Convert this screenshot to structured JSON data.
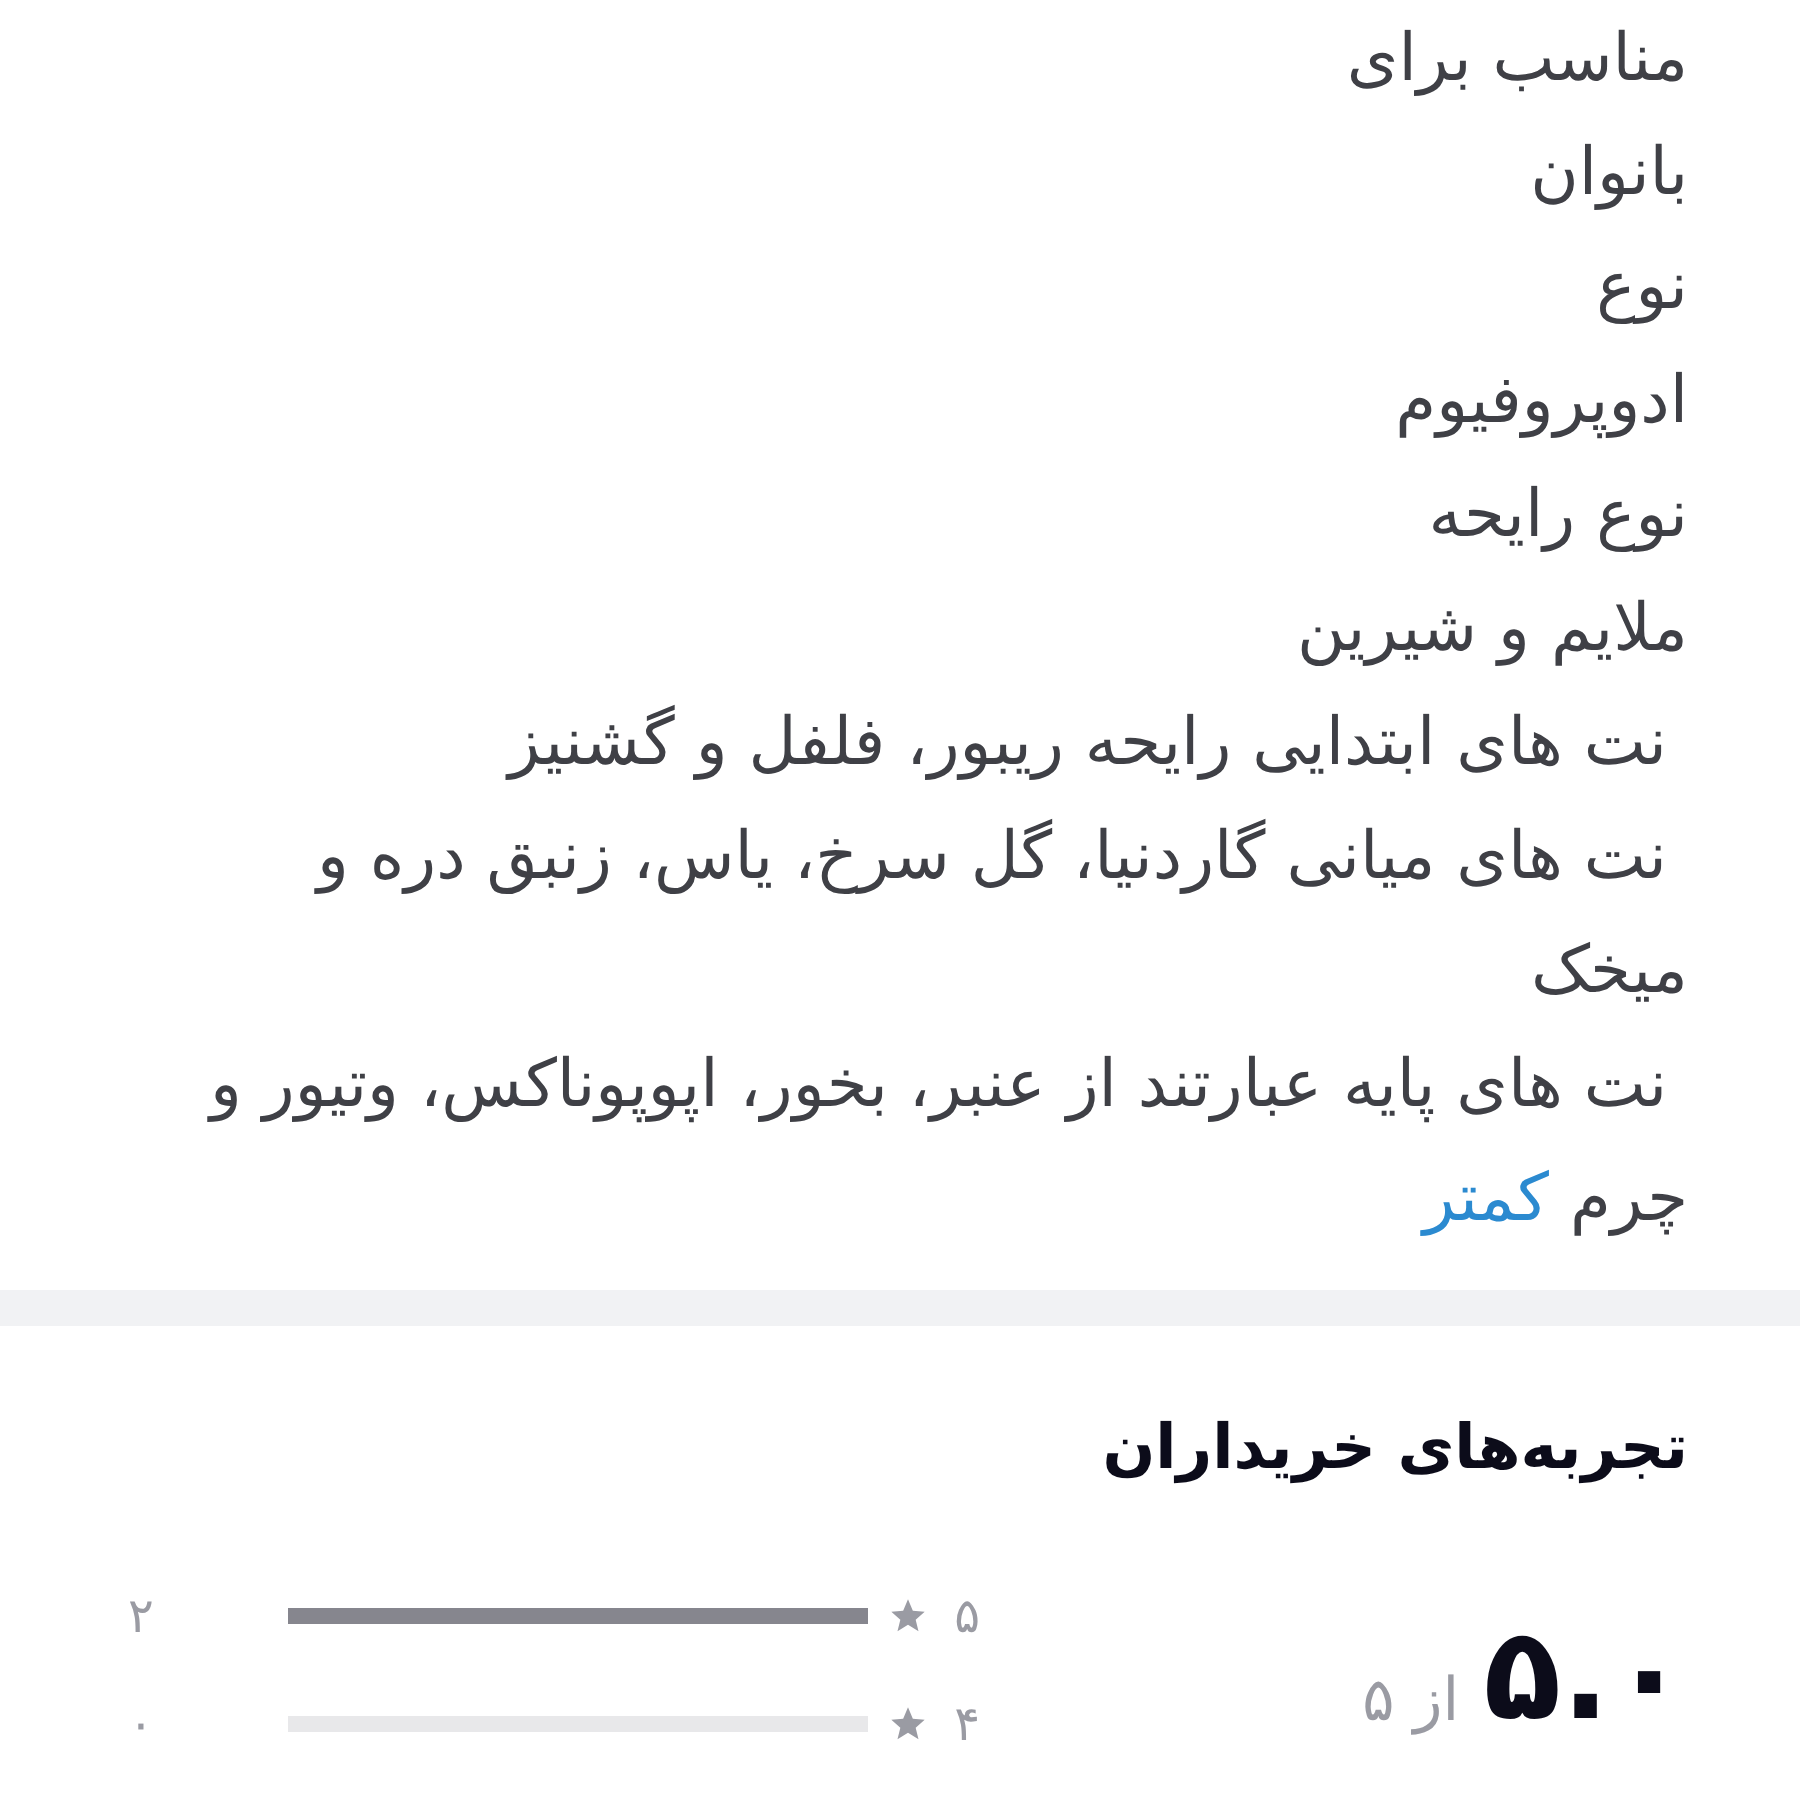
{
  "specs": [
    {
      "label": "مناسب برای",
      "value": "بانوان"
    },
    {
      "label": "نوع",
      "value": "ادوپروفیوم"
    },
    {
      "label": "نوع رایحه",
      "value": "ملایم و شیرین"
    }
  ],
  "notes": [
    " نت های ابتدایی رایحه ریبور، فلفل و گشنیز",
    " نت های میانی گاردنیا، گل سرخ، یاس، زنبق دره و میخک",
    " نت های پایه عبارتند از عنبر، بخور، اپوپوناکس، وتیور و چرم"
  ],
  "less_link": "کمتر",
  "reviews": {
    "title": "تجربه‌های خریداران",
    "average": "۵.۰",
    "out_of": "از ۵",
    "distribution": [
      {
        "star": "۵",
        "level": 1,
        "count": "۲"
      },
      {
        "star": "۴",
        "level": 0,
        "count": "۰"
      }
    ]
  }
}
